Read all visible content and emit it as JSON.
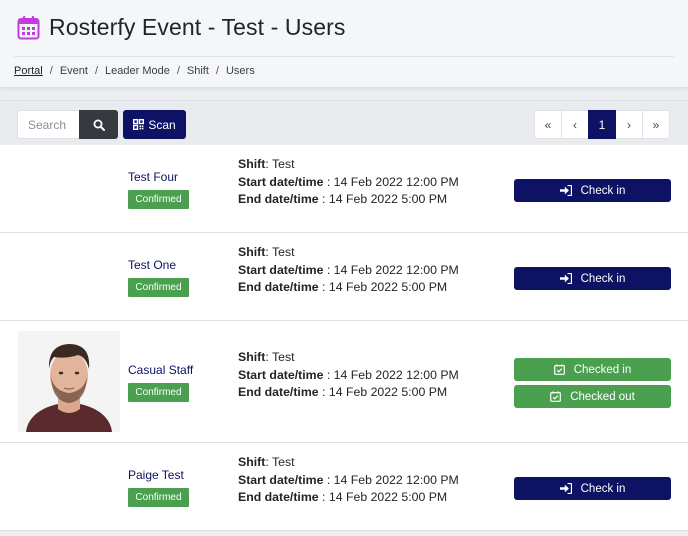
{
  "header": {
    "title": "Rosterfy Event - Test - Users",
    "breadcrumb": [
      "Portal",
      "Event",
      "Leader Mode",
      "Shift",
      "Users"
    ],
    "icon": "calendar-icon",
    "accent": "#c23ae0"
  },
  "toolbar": {
    "search_placeholder": "Search",
    "scan_label": "Scan",
    "pagination": [
      "«",
      "‹",
      "1",
      "›",
      "»"
    ]
  },
  "labels": {
    "shift": "Shift",
    "start": "Start date/time",
    "end": "End date/time"
  },
  "users": [
    {
      "name": "Test Four",
      "status": "Confirmed",
      "shift": "Test",
      "start": "14 Feb 2022 12:00 PM",
      "end": "14 Feb 2022 5:00 PM",
      "actions": [
        "Check in"
      ]
    },
    {
      "name": "Test One",
      "status": "Confirmed",
      "shift": "Test",
      "start": "14 Feb 2022 12:00 PM",
      "end": "14 Feb 2022 5:00 PM",
      "actions": [
        "Check in"
      ]
    },
    {
      "name": "Casual Staff",
      "status": "Confirmed",
      "shift": "Test",
      "start": "14 Feb 2022 12:00 PM",
      "end": "14 Feb 2022 5:00 PM",
      "actions": [
        "Checked in",
        "Checked out"
      ]
    },
    {
      "name": "Paige Test",
      "status": "Confirmed",
      "shift": "Test",
      "start": "14 Feb 2022 12:00 PM",
      "end": "14 Feb 2022 5:00 PM",
      "actions": [
        "Check in"
      ]
    }
  ],
  "colors": {
    "primary": "#0d1264",
    "success": "#4aa04f"
  }
}
